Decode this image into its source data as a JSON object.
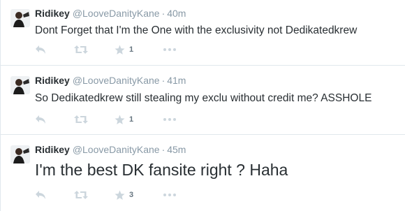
{
  "colors": {
    "text": "#292f33",
    "secondary": "#8899a6",
    "icon": "#ccd6dd",
    "divider": "#e1e8ed"
  },
  "icons": [
    "reply-icon",
    "retweet-icon",
    "favorite-star-icon",
    "more-dots-icon"
  ],
  "tweets": [
    {
      "name": "Ridikey",
      "handle": "@LooveDanityKane",
      "separator": "·",
      "time": "40m",
      "text": "Dont Forget that I'm the One with the exclusivity not Dedikatedkrew",
      "favorites": "1"
    },
    {
      "name": "Ridikey",
      "handle": "@LooveDanityKane",
      "separator": "·",
      "time": "41m",
      "text": "So Dedikatedkrew still stealing my exclu without credit me? ASSHOLE",
      "favorites": "1"
    },
    {
      "name": "Ridikey",
      "handle": "@LooveDanityKane",
      "separator": "·",
      "time": "45m",
      "text": "I'm the best DK fansite right ? Haha",
      "favorites": "3"
    }
  ]
}
